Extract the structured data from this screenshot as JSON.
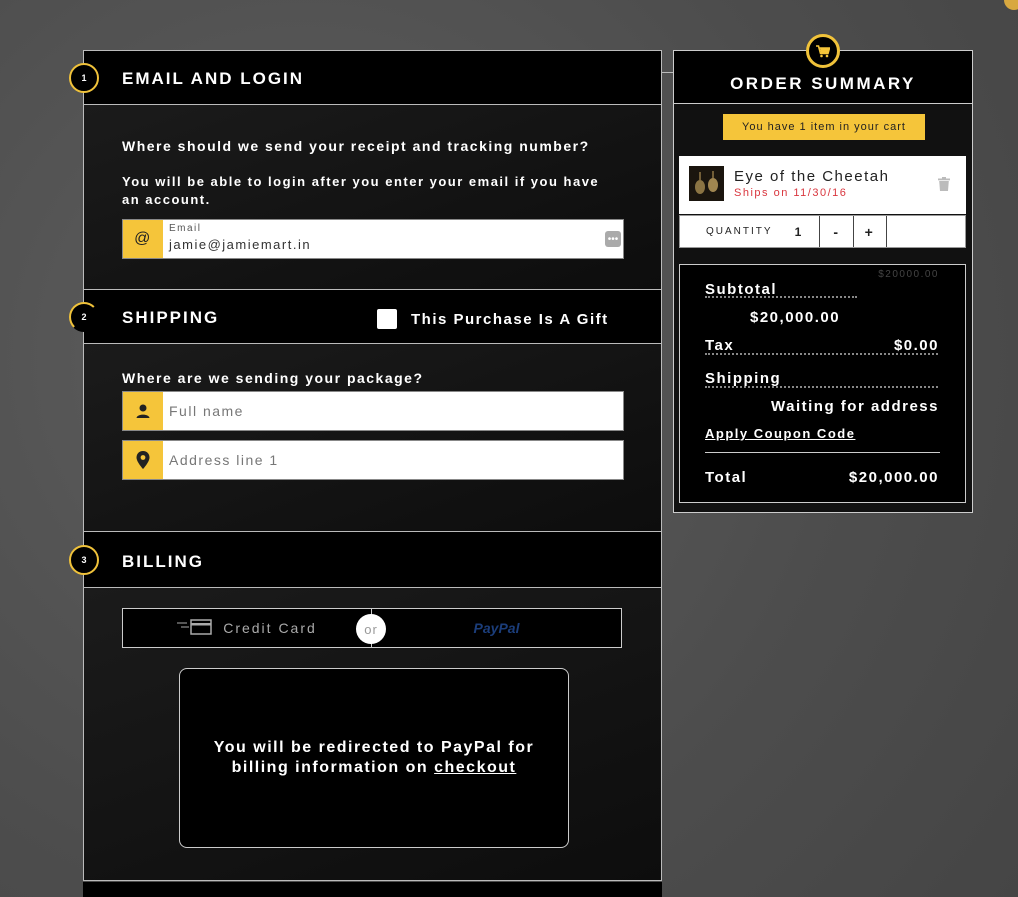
{
  "email_section": {
    "step": "1",
    "title": "EMAIL AND LOGIN",
    "question": "Where should we send your receipt and tracking number?",
    "subtext": "You will be able to login after you enter your email if you have an account.",
    "email_label": "Email",
    "email_value": "jamie@jamiemart.in"
  },
  "shipping_section": {
    "step": "2",
    "title": "SHIPPING",
    "gift_label": "This Purchase Is A Gift",
    "question": "Where are we sending your package?",
    "fullname_placeholder": "Full name",
    "address_placeholder": "Address line 1"
  },
  "billing_section": {
    "step": "3",
    "title": "BILLING",
    "credit_card_label": "Credit Card",
    "or_label": "or",
    "paypal_label": "PayPal",
    "redirect_text": "You will be redirected to PayPal for billing information on",
    "checkout_link": "checkout"
  },
  "order_summary": {
    "title": "ORDER SUMMARY",
    "cart_note": "You have 1 item in your cart",
    "item": {
      "name": "Eye of the Cheetah",
      "ships": "Ships on 11/30/16"
    },
    "quantity_label": "QUANTITY",
    "quantity_value": "1",
    "decrement_label": "-",
    "increment_label": "+",
    "faded_price": "$20000.00",
    "subtotal_label": "Subtotal",
    "subtotal_value": "$20,000.00",
    "tax_label": "Tax",
    "tax_value": "$0.00",
    "shipping_label": "Shipping",
    "shipping_value": "Waiting for address",
    "coupon_label": "Apply Coupon Code",
    "total_label": "Total",
    "total_value": "$20,000.00"
  },
  "colors": {
    "accent": "#f5c53a",
    "ship_date": "#d9363e"
  }
}
